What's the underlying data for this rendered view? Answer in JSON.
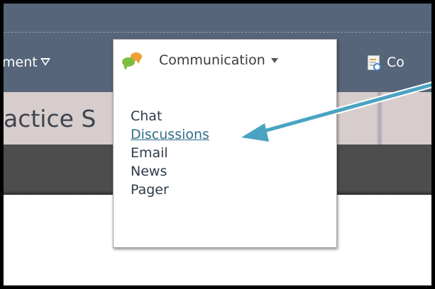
{
  "navbar": {
    "management_label": "ment",
    "course_label": "Co"
  },
  "title": {
    "text": "actice S"
  },
  "dropdown": {
    "header_label": "Communication",
    "items": [
      {
        "label": "Chat"
      },
      {
        "label": "Discussions"
      },
      {
        "label": "Email"
      },
      {
        "label": "News"
      },
      {
        "label": "Pager"
      }
    ]
  },
  "colors": {
    "navbar": "#566579",
    "title_bar": "#d7cdcc",
    "dark_bar": "#4d4d4d",
    "arrow": "#4aa3c2",
    "link": "#2f6e86"
  },
  "icons": {
    "communication": "chat-bubbles-icon",
    "course_tools": "document-search-icon",
    "management_caret": "triangle-down-outline-icon",
    "communication_caret": "triangle-down-icon",
    "callout": "arrow-icon"
  }
}
